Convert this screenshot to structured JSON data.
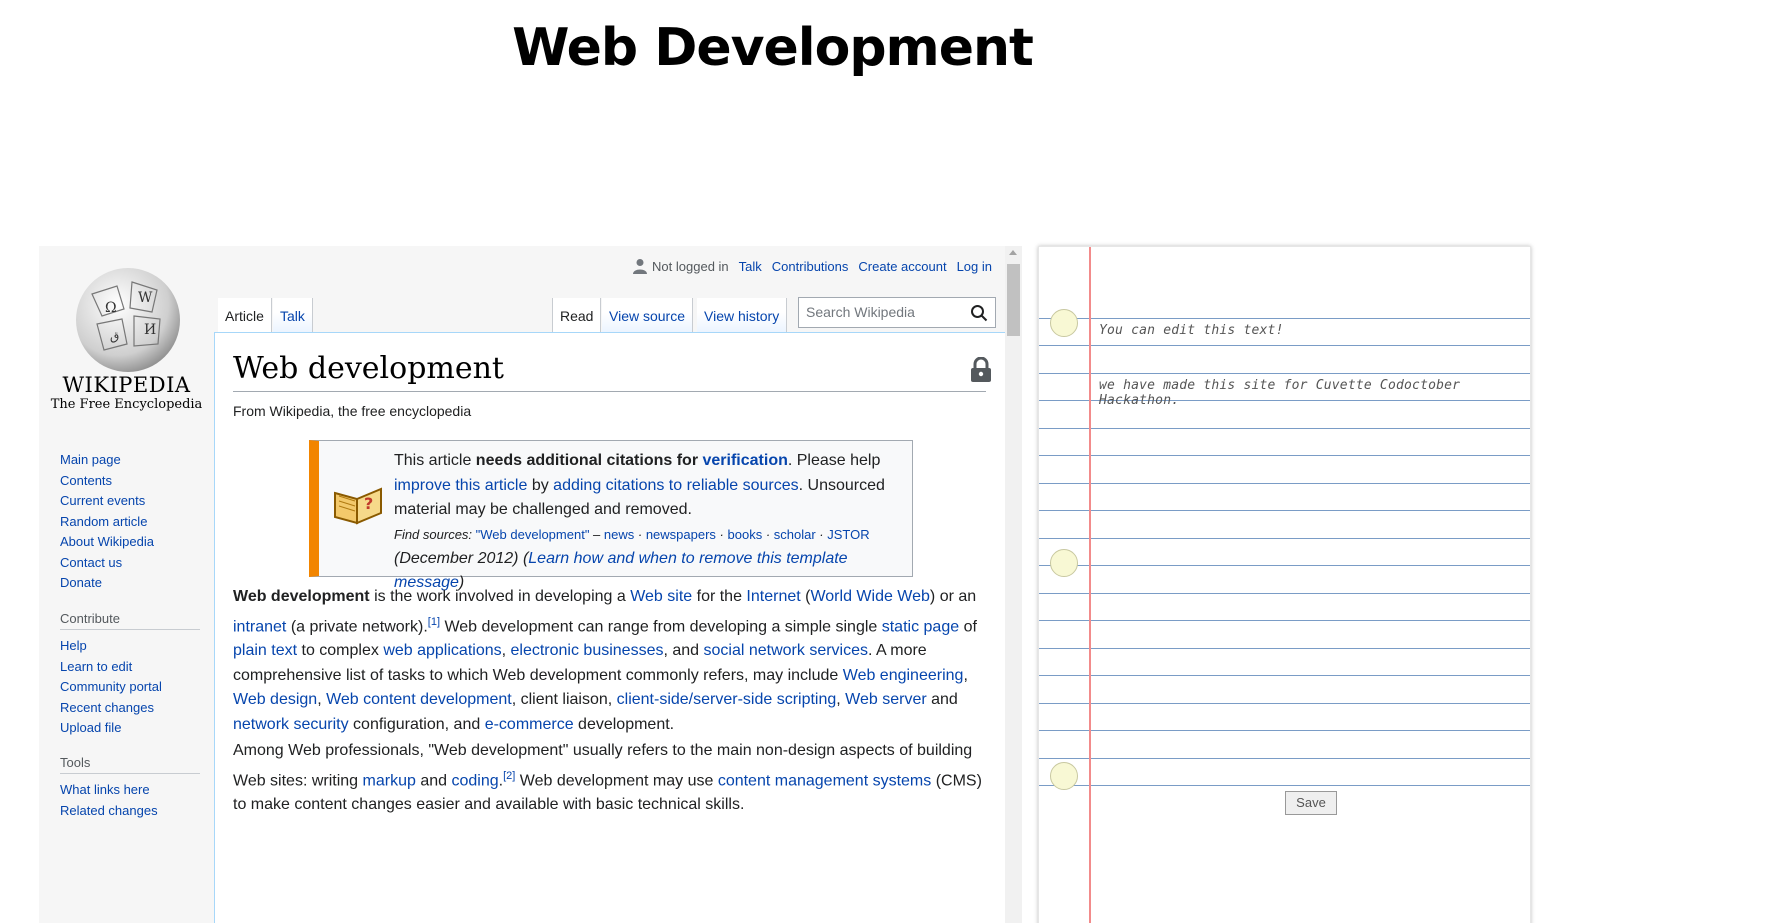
{
  "page": {
    "title": "Web Development"
  },
  "wiki": {
    "logo": {
      "wordmark": "Wikipedia",
      "tagline": "The Free Encyclopedia"
    },
    "user_links": {
      "status": "Not logged in",
      "talk": "Talk",
      "contributions": "Contributions",
      "create_account": "Create account",
      "log_in": "Log in"
    },
    "tabs": {
      "article": "Article",
      "talk": "Talk",
      "read": "Read",
      "view_source": "View source",
      "view_history": "View history"
    },
    "search": {
      "placeholder": "Search Wikipedia"
    },
    "navigation": [
      "Main page",
      "Contents",
      "Current events",
      "Random article",
      "About Wikipedia",
      "Contact us",
      "Donate"
    ],
    "contribute": {
      "heading": "Contribute",
      "items": [
        "Help",
        "Learn to edit",
        "Community portal",
        "Recent changes",
        "Upload file"
      ]
    },
    "tools": {
      "heading": "Tools",
      "items": [
        "What links here",
        "Related changes"
      ]
    },
    "article": {
      "title": "Web development",
      "from": "From Wikipedia, the free encyclopedia",
      "ambox": {
        "t1": "This article ",
        "t2": "needs additional citations for ",
        "t3": "verification",
        "t4": ". Please help ",
        "t5": "improve this article",
        "t6": " by ",
        "t7": "adding citations to reliable sources",
        "t8": ". Unsourced material may be challenged and removed.",
        "find_label": "Find sources: ",
        "find_query": "\"Web development\"",
        "find_news": "news",
        "find_newspapers": "newspapers",
        "find_books": "books",
        "find_scholar": "scholar",
        "find_jstor": "JSTOR",
        "date": "(December 2012)",
        "learn": "Learn how and when to remove this template message"
      },
      "p1": {
        "a1": "Web development",
        "a2": " is the work involved in developing a ",
        "a3": "Web site",
        "a4": " for the ",
        "a5": "Internet",
        "a6": " (",
        "a7": "World Wide Web",
        "a8": ") or an ",
        "a9": "intranet",
        "a10": " (a private network).",
        "a11": "[1]",
        "a12": " Web development can range from developing a simple single ",
        "a13": "static page",
        "a14": " of ",
        "a15": "plain text",
        "a16": " to complex ",
        "a17": "web applications",
        "a18": ", ",
        "a19": "electronic businesses",
        "a20": ", and ",
        "a21": "social network services",
        "a22": ". A more comprehensive list of tasks to which Web development commonly refers, may include ",
        "a23": "Web engineering",
        "a24": ", ",
        "a25": "Web design",
        "a26": ", ",
        "a27": "Web content development",
        "a28": ", client liaison, ",
        "a29": "client-side/server-side scripting",
        "a30": ", ",
        "a31": "Web server",
        "a32": " and ",
        "a33": "network security",
        "a34": " configuration, and ",
        "a35": "e-commerce",
        "a36": " development."
      },
      "p2": {
        "b1": "Among Web professionals, \"Web development\" usually refers to the main non-design aspects of building Web sites: writing ",
        "b2": "markup",
        "b3": " and ",
        "b4": "coding",
        "b5": ".",
        "b6": "[2]",
        "b7": " Web development may use ",
        "b8": "content management systems",
        "b9": " (CMS) to make content changes easier and available with basic technical skills."
      }
    }
  },
  "notebook": {
    "line1": "You can edit this text!",
    "line2": "we have made this site for Cuvette Codoctober Hackathon.",
    "save_label": "Save"
  }
}
